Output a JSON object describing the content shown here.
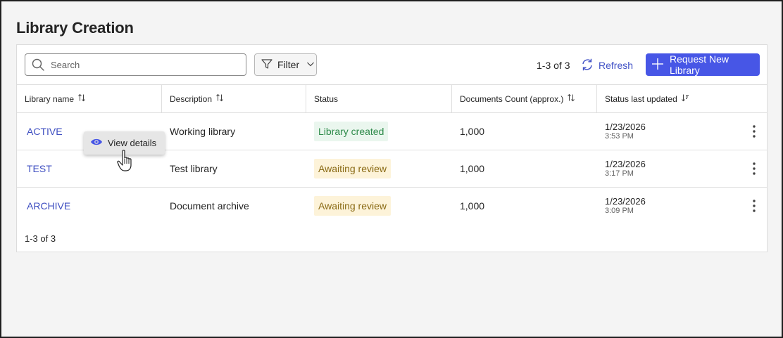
{
  "page": {
    "title": "Library Creation"
  },
  "toolbar": {
    "search_placeholder": "Search",
    "filter_label": "Filter",
    "count": "1-3 of 3",
    "refresh_label": "Refresh",
    "request_label": "Request New Library",
    "accent": "#4756e6"
  },
  "table": {
    "columns": [
      {
        "label": "Library name",
        "sort": "sortable"
      },
      {
        "label": "Description",
        "sort": "sortable"
      },
      {
        "label": "Status",
        "sort": "none"
      },
      {
        "label": "Documents Count (approx.)",
        "sort": "sortable"
      },
      {
        "label": "Status last updated",
        "sort": "descending"
      }
    ],
    "rows": [
      {
        "name": "ACTIVE",
        "description": "Working library",
        "status": "Library created",
        "status_color": "#2e8a4a",
        "count": "1,000",
        "date": "1/23/2026",
        "time": "3:53 PM"
      },
      {
        "name": "TEST",
        "description": "Test library",
        "status": "Awaiting review",
        "status_color": "#8a6a14",
        "count": "1,000",
        "date": "1/23/2026",
        "time": "3:17 PM"
      },
      {
        "name": "ARCHIVE",
        "description": "Document archive",
        "status": "Awaiting review",
        "status_color": "#8a6a14",
        "count": "1,000",
        "date": "1/23/2026",
        "time": "3:09 PM"
      }
    ],
    "footer_count": "1-3 of 3"
  },
  "tooltip": {
    "label": "View details",
    "icon": "eye-icon"
  }
}
